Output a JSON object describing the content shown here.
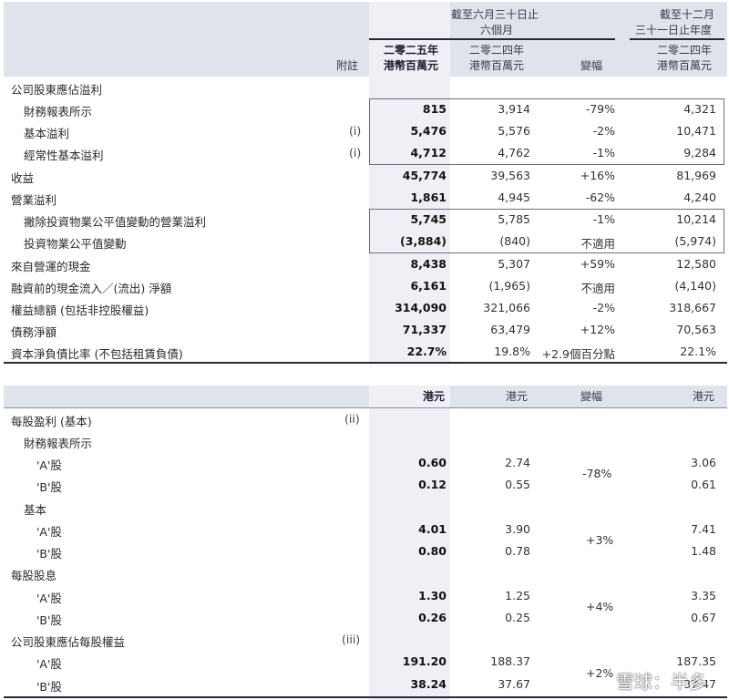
{
  "section1": {
    "header": {
      "period6m_line1": "截至六月三十日止",
      "period6m_line2": "六個月",
      "fy_line1": "截至十二月",
      "fy_line2": "三十一日止年度",
      "note_label": "附註",
      "y2025": "二零二五年",
      "y2024": "二零二四年",
      "unit": "港幣百萬元",
      "variance": "變幅",
      "fy_year": "二零二四年",
      "fy_unit": "港幣百萬元"
    },
    "rows": [
      {
        "label": "公司股東應佔溢利",
        "note": "",
        "v2025": "",
        "v2024": "",
        "var": "",
        "fy": ""
      },
      {
        "label": "財務報表所示",
        "note": "",
        "v2025": "815",
        "v2024": "3,914",
        "var": "-79%",
        "fy": "4,321"
      },
      {
        "label": "基本溢利",
        "note": "(i)",
        "v2025": "5,476",
        "v2024": "5,576",
        "var": "-2%",
        "fy": "10,471"
      },
      {
        "label": "經常性基本溢利",
        "note": "(i)",
        "v2025": "4,712",
        "v2024": "4,762",
        "var": "-1%",
        "fy": "9,284"
      },
      {
        "label": "收益",
        "note": "",
        "v2025": "45,774",
        "v2024": "39,563",
        "var": "+16%",
        "fy": "81,969"
      },
      {
        "label": "營業溢利",
        "note": "",
        "v2025": "1,861",
        "v2024": "4,945",
        "var": "-62%",
        "fy": "4,240"
      },
      {
        "label": "撇除投資物業公平值變動的營業溢利",
        "note": "",
        "v2025": "5,745",
        "v2024": "5,785",
        "var": "-1%",
        "fy": "10,214"
      },
      {
        "label": "投資物業公平值變動",
        "note": "",
        "v2025": "(3,884)",
        "v2024": "(840)",
        "var": "不適用",
        "fy": "(5,974)"
      },
      {
        "label": "來自營運的現金",
        "note": "",
        "v2025": "8,438",
        "v2024": "5,307",
        "var": "+59%",
        "fy": "12,580"
      },
      {
        "label": "融資前的現金流入／(流出) 淨額",
        "note": "",
        "v2025": "6,161",
        "v2024": "(1,965)",
        "var": "不適用",
        "fy": "(4,140)"
      },
      {
        "label": "權益總額 (包括非控股權益)",
        "note": "",
        "v2025": "314,090",
        "v2024": "321,066",
        "var": "-2%",
        "fy": "318,667"
      },
      {
        "label": "債務淨額",
        "note": "",
        "v2025": "71,337",
        "v2024": "63,479",
        "var": "+12%",
        "fy": "70,563"
      },
      {
        "label": "資本淨負債比率 (不包括租賃負債)",
        "note": "",
        "v2025": "22.7%",
        "v2024": "19.8%",
        "var": "+2.9個百分點",
        "fy": "22.1%"
      }
    ]
  },
  "section2": {
    "header": {
      "unit2025": "港元",
      "unit2024": "港元",
      "variance": "變幅",
      "unit_fy": "港元"
    },
    "rows": [
      {
        "label": "每股盈利 (基本)",
        "note": "(ii)",
        "v2025": "",
        "v2024": "",
        "fy": ""
      },
      {
        "label": "財務報表所示",
        "note": "",
        "v2025": "",
        "v2024": "",
        "fy": ""
      },
      {
        "label": "'A'股",
        "note": "",
        "v2025": "0.60",
        "v2024": "2.74",
        "fy": "3.06"
      },
      {
        "label": "'B'股",
        "note": "",
        "v2025": "0.12",
        "v2024": "0.55",
        "fy": "0.61"
      },
      {
        "label": "基本",
        "note": "",
        "v2025": "",
        "v2024": "",
        "fy": ""
      },
      {
        "label": "'A'股",
        "note": "",
        "v2025": "4.01",
        "v2024": "3.90",
        "fy": "7.41"
      },
      {
        "label": "'B'股",
        "note": "",
        "v2025": "0.80",
        "v2024": "0.78",
        "fy": "1.48"
      },
      {
        "label": "每股股息",
        "note": "",
        "v2025": "",
        "v2024": "",
        "fy": ""
      },
      {
        "label": "'A'股",
        "note": "",
        "v2025": "1.30",
        "v2024": "1.25",
        "fy": "3.35"
      },
      {
        "label": "'B'股",
        "note": "",
        "v2025": "0.26",
        "v2024": "0.25",
        "fy": "0.67"
      },
      {
        "label": "公司股東應佔每股權益",
        "note": "(iii)",
        "v2025": "",
        "v2024": "",
        "fy": ""
      },
      {
        "label": "'A'股",
        "note": "",
        "v2025": "191.20",
        "v2024": "188.37",
        "fy": "187.35"
      },
      {
        "label": "'B'股",
        "note": "",
        "v2025": "38.24",
        "v2024": "37.67",
        "fy": "37.47"
      }
    ],
    "merged_variances": [
      "-78%",
      "+3%",
      "+4%",
      "+2%"
    ]
  },
  "watermark": "雪球：半多"
}
